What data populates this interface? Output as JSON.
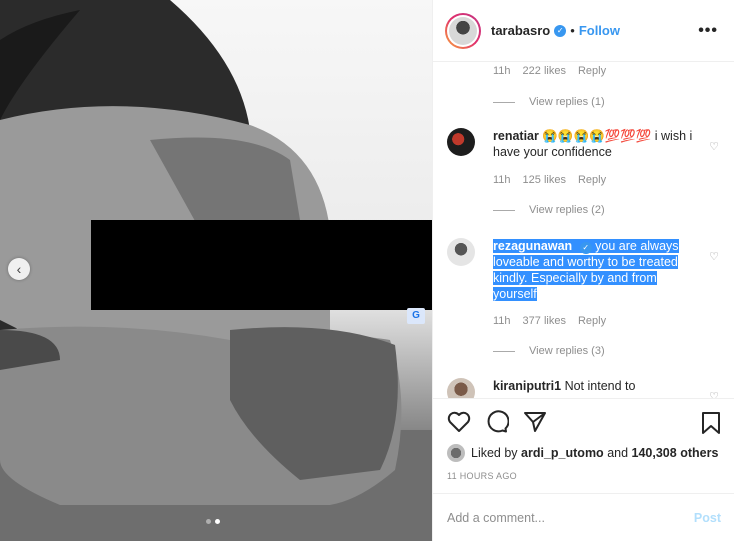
{
  "post": {
    "username": "tarabasro",
    "follow_label": "Follow",
    "more_label": "•••",
    "separator": "•"
  },
  "comments": [
    {
      "type": "meta",
      "time": "11h",
      "likes": "222 likes",
      "reply": "Reply"
    },
    {
      "type": "replies",
      "label": "View replies (1)"
    },
    {
      "type": "comment",
      "user": "renatiar",
      "text": "😭😭😭😭💯💯💯 i wish i have your confidence",
      "time": "11h",
      "likes": "125 likes",
      "reply": "Reply"
    },
    {
      "type": "replies",
      "label": "View replies (2)"
    },
    {
      "type": "comment",
      "user": "rezagunawan",
      "text": "you are always loveable and worthy to be treated kindly. Especially by and from yourself",
      "time": "11h",
      "likes": "377 likes",
      "reply": "Reply"
    },
    {
      "type": "replies",
      "label": "View replies (3)"
    },
    {
      "type": "comment",
      "user": "kiraniputri1",
      "text": "Not intend to"
    }
  ],
  "likes_line": {
    "prefix": "Liked by",
    "user": "ardi_p_utomo",
    "and": "and",
    "count": "140,308 others"
  },
  "time_ago": "11 HOURS AGO",
  "comment_box": {
    "placeholder": "Add a comment...",
    "post_label": "Post"
  },
  "colors": {
    "accent": "#3897f0",
    "highlight": "#3390ff",
    "muted": "#8e8e8e"
  }
}
